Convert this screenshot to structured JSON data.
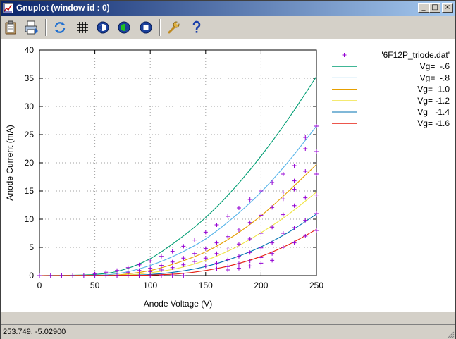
{
  "window": {
    "title": "Gnuplot (window id : 0)"
  },
  "title_buttons": {
    "minimize": "_",
    "maximize": "□",
    "close": "×"
  },
  "toolbar": [
    {
      "name": "copy-clipboard-button",
      "icon": "clipboard-icon"
    },
    {
      "name": "print-button",
      "icon": "printer-icon"
    },
    {
      "name": "replot-button",
      "icon": "refresh-icon"
    },
    {
      "name": "grid-toggle-button",
      "icon": "grid-icon"
    },
    {
      "name": "previous-zoom-button",
      "icon": "zoom-previous-icon"
    },
    {
      "name": "next-zoom-button",
      "icon": "zoom-next-icon"
    },
    {
      "name": "autoscale-button",
      "icon": "autoscale-icon"
    },
    {
      "name": "options-button",
      "icon": "wrench-icon"
    },
    {
      "name": "help-button",
      "icon": "help-icon"
    }
  ],
  "status": {
    "text": "253.749, -5.02900"
  },
  "colors": {
    "points": "#9400d3",
    "series": [
      "#009e73",
      "#56b4e9",
      "#e69f00",
      "#f0e442",
      "#0072b2",
      "#e51e10"
    ],
    "grid": "#a0a0a0"
  },
  "chart_data": {
    "type": "line",
    "xlabel": "Anode Voltage (V)",
    "ylabel": "Anode Current (mA)",
    "xlim": [
      0,
      250
    ],
    "ylim": [
      0,
      40
    ],
    "xticks": [
      0,
      50,
      100,
      150,
      200,
      250
    ],
    "yticks": [
      0,
      5,
      10,
      15,
      20,
      25,
      30,
      35,
      40
    ],
    "grid": true,
    "legend_position": "outside-right",
    "points_label": "'6F12P_triode.dat'",
    "points_symbol": "+",
    "series": [
      {
        "name": "Vg=  -.6",
        "x": [
          0,
          50,
          75,
          100,
          125,
          150,
          175,
          200,
          225,
          250
        ],
        "y": [
          0,
          0.2,
          1.0,
          3.0,
          6.3,
          10.3,
          15.3,
          21.2,
          27.9,
          35.3
        ]
      },
      {
        "name": "Vg=  -.8",
        "x": [
          0,
          50,
          75,
          100,
          125,
          150,
          175,
          200,
          225,
          250
        ],
        "y": [
          0,
          0.05,
          0.5,
          1.8,
          3.8,
          6.5,
          10.3,
          14.8,
          20.3,
          26.5
        ]
      },
      {
        "name": "Vg= -1.0",
        "x": [
          0,
          60,
          75,
          100,
          125,
          150,
          175,
          200,
          225,
          250
        ],
        "y": [
          0,
          0.05,
          0.2,
          0.9,
          2.3,
          4.2,
          7.0,
          10.6,
          15.0,
          19.7
        ]
      },
      {
        "name": "Vg= -1.2",
        "x": [
          0,
          75,
          100,
          125,
          150,
          175,
          200,
          225,
          250
        ],
        "y": [
          0,
          0.1,
          0.5,
          1.3,
          2.7,
          4.8,
          7.6,
          10.9,
          14.8
        ]
      },
      {
        "name": "Vg= -1.4",
        "x": [
          0,
          75,
          100,
          125,
          150,
          175,
          200,
          225,
          250
        ],
        "y": [
          0,
          0.05,
          0.2,
          0.7,
          1.6,
          3.1,
          5.1,
          7.7,
          10.9
        ]
      },
      {
        "name": "Vg= -1.6",
        "x": [
          0,
          90,
          100,
          125,
          150,
          175,
          200,
          225,
          250
        ],
        "y": [
          0,
          0.05,
          0.1,
          0.3,
          0.9,
          1.9,
          3.4,
          5.5,
          8.2
        ]
      }
    ],
    "points": [
      [
        0,
        0
      ],
      [
        10,
        0
      ],
      [
        20,
        0
      ],
      [
        30,
        0
      ],
      [
        40,
        0
      ],
      [
        50,
        0
      ],
      [
        60,
        0
      ],
      [
        70,
        0
      ],
      [
        80,
        0
      ],
      [
        90,
        0
      ],
      [
        100,
        0
      ],
      [
        110,
        0
      ],
      [
        120,
        0
      ],
      [
        130,
        0
      ],
      [
        50,
        0.3
      ],
      [
        60,
        0.6
      ],
      [
        70,
        0.9
      ],
      [
        80,
        1.4
      ],
      [
        90,
        1.9
      ],
      [
        100,
        2.6
      ],
      [
        110,
        3.4
      ],
      [
        120,
        4.3
      ],
      [
        130,
        5.2
      ],
      [
        140,
        6.3
      ],
      [
        150,
        7.7
      ],
      [
        160,
        9.0
      ],
      [
        170,
        10.5
      ],
      [
        180,
        12.0
      ],
      [
        190,
        13.5
      ],
      [
        200,
        15.0
      ],
      [
        210,
        16.5
      ],
      [
        220,
        18.0
      ],
      [
        230,
        19.5
      ],
      [
        240,
        24.5
      ],
      [
        250,
        26.5
      ],
      [
        80,
        0.6
      ],
      [
        90,
        0.9
      ],
      [
        100,
        1.3
      ],
      [
        110,
        1.8
      ],
      [
        120,
        2.4
      ],
      [
        130,
        3.1
      ],
      [
        140,
        3.9
      ],
      [
        150,
        4.8
      ],
      [
        160,
        5.8
      ],
      [
        170,
        6.9
      ],
      [
        180,
        8.1
      ],
      [
        190,
        9.4
      ],
      [
        200,
        10.7
      ],
      [
        210,
        12.1
      ],
      [
        220,
        13.6
      ],
      [
        230,
        15.3
      ],
      [
        240,
        22.5
      ],
      [
        250,
        22.0
      ],
      [
        100,
        0.7
      ],
      [
        110,
        1.0
      ],
      [
        120,
        1.4
      ],
      [
        130,
        1.9
      ],
      [
        140,
        2.5
      ],
      [
        150,
        3.1
      ],
      [
        160,
        3.9
      ],
      [
        170,
        4.7
      ],
      [
        180,
        5.6
      ],
      [
        190,
        6.5
      ],
      [
        200,
        7.5
      ],
      [
        210,
        8.6
      ],
      [
        220,
        14.8
      ],
      [
        230,
        16.8
      ],
      [
        240,
        18.5
      ],
      [
        250,
        18.0
      ],
      [
        150,
        1.7
      ],
      [
        160,
        2.2
      ],
      [
        170,
        2.8
      ],
      [
        180,
        3.4
      ],
      [
        190,
        4.1
      ],
      [
        200,
        4.9
      ],
      [
        210,
        5.8
      ],
      [
        220,
        10.8
      ],
      [
        230,
        12.4
      ],
      [
        240,
        13.8
      ],
      [
        250,
        14.3
      ],
      [
        160,
        1.2
      ],
      [
        170,
        1.6
      ],
      [
        180,
        2.1
      ],
      [
        190,
        2.6
      ],
      [
        200,
        3.2
      ],
      [
        210,
        3.9
      ],
      [
        220,
        7.5
      ],
      [
        230,
        8.5
      ],
      [
        240,
        9.8
      ],
      [
        250,
        11.0
      ],
      [
        170,
        1.0
      ],
      [
        180,
        1.3
      ],
      [
        190,
        1.7
      ],
      [
        200,
        2.2
      ],
      [
        210,
        2.7
      ],
      [
        220,
        5.0
      ],
      [
        230,
        5.8
      ],
      [
        240,
        7.0
      ],
      [
        250,
        8.0
      ]
    ]
  }
}
